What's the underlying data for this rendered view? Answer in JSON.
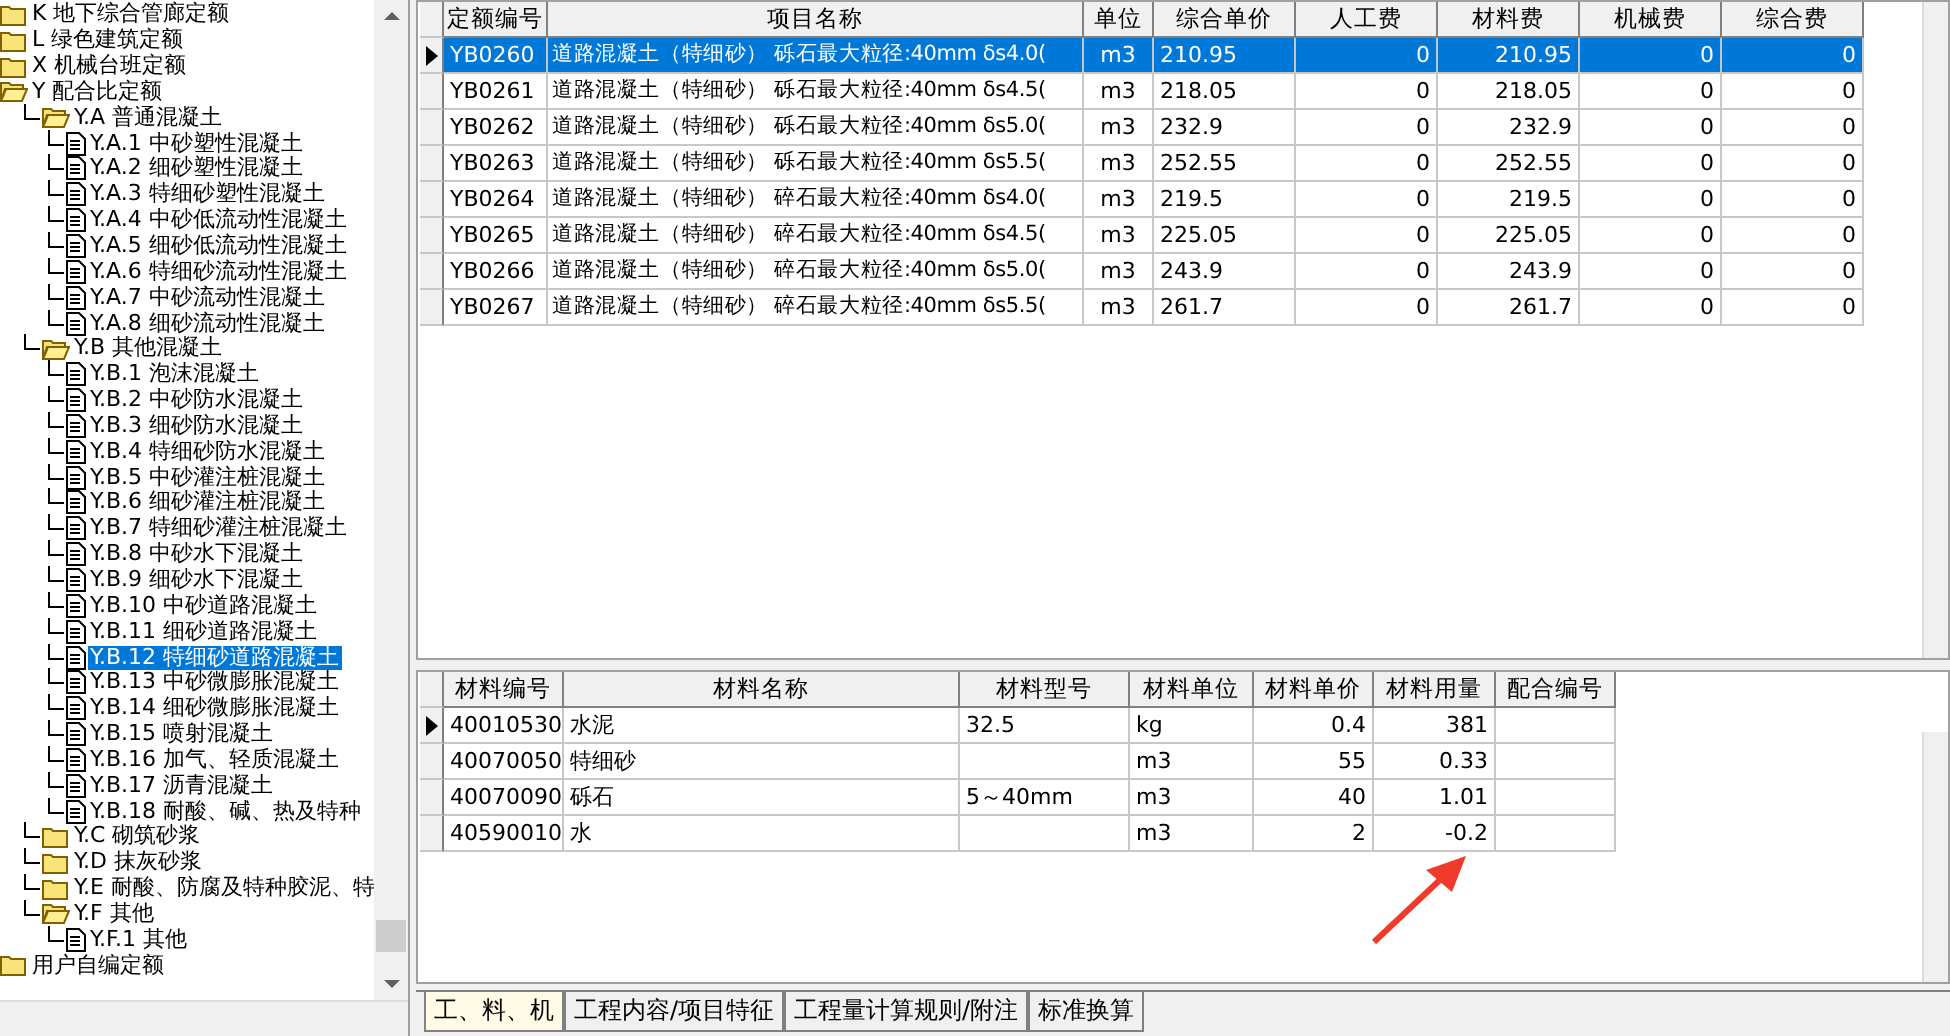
{
  "tree": {
    "items": [
      {
        "label": "K 地下综合管廊定额",
        "kind": "folder",
        "expanded": false,
        "selected": false
      },
      {
        "label": "L 绿色建筑定额",
        "kind": "folder",
        "expanded": false,
        "selected": false
      },
      {
        "label": "X 机械台班定额",
        "kind": "folder",
        "expanded": false,
        "selected": false
      },
      {
        "label": "Y 配合比定额",
        "kind": "folder",
        "expanded": true,
        "selected": false,
        "children": [
          {
            "label": "Y.A 普通混凝土",
            "kind": "folder",
            "expanded": true,
            "selected": false,
            "children": [
              {
                "label": "Y.A.1 中砂塑性混凝土",
                "kind": "doc",
                "selected": false
              },
              {
                "label": "Y.A.2 细砂塑性混凝土",
                "kind": "doc",
                "selected": false
              },
              {
                "label": "Y.A.3 特细砂塑性混凝土",
                "kind": "doc",
                "selected": false
              },
              {
                "label": "Y.A.4 中砂低流动性混凝土",
                "kind": "doc",
                "selected": false
              },
              {
                "label": "Y.A.5 细砂低流动性混凝土",
                "kind": "doc",
                "selected": false
              },
              {
                "label": "Y.A.6 特细砂流动性混凝土",
                "kind": "doc",
                "selected": false
              },
              {
                "label": "Y.A.7 中砂流动性混凝土",
                "kind": "doc",
                "selected": false
              },
              {
                "label": "Y.A.8 细砂流动性混凝土",
                "kind": "doc",
                "selected": false
              }
            ]
          },
          {
            "label": "Y.B 其他混凝土",
            "kind": "folder",
            "expanded": true,
            "selected": false,
            "children": [
              {
                "label": "Y.B.1 泡沫混凝土",
                "kind": "doc",
                "selected": false
              },
              {
                "label": "Y.B.2 中砂防水混凝土",
                "kind": "doc",
                "selected": false
              },
              {
                "label": "Y.B.3 细砂防水混凝土",
                "kind": "doc",
                "selected": false
              },
              {
                "label": "Y.B.4 特细砂防水混凝土",
                "kind": "doc",
                "selected": false
              },
              {
                "label": "Y.B.5 中砂灌注桩混凝土",
                "kind": "doc",
                "selected": false
              },
              {
                "label": "Y.B.6 细砂灌注桩混凝土",
                "kind": "doc",
                "selected": false
              },
              {
                "label": "Y.B.7 特细砂灌注桩混凝土",
                "kind": "doc",
                "selected": false
              },
              {
                "label": "Y.B.8 中砂水下混凝土",
                "kind": "doc",
                "selected": false
              },
              {
                "label": "Y.B.9 细砂水下混凝土",
                "kind": "doc",
                "selected": false
              },
              {
                "label": "Y.B.10 中砂道路混凝土",
                "kind": "doc",
                "selected": false
              },
              {
                "label": "Y.B.11 细砂道路混凝土",
                "kind": "doc",
                "selected": false
              },
              {
                "label": "Y.B.12 特细砂道路混凝土",
                "kind": "doc",
                "selected": true
              },
              {
                "label": "Y.B.13 中砂微膨胀混凝土",
                "kind": "doc",
                "selected": false
              },
              {
                "label": "Y.B.14 细砂微膨胀混凝土",
                "kind": "doc",
                "selected": false
              },
              {
                "label": "Y.B.15 喷射混凝土",
                "kind": "doc",
                "selected": false
              },
              {
                "label": "Y.B.16 加气、轻质混凝土",
                "kind": "doc",
                "selected": false
              },
              {
                "label": "Y.B.17 沥青混凝土",
                "kind": "doc",
                "selected": false
              },
              {
                "label": "Y.B.18 耐酸、碱、热及特种",
                "kind": "doc",
                "selected": false
              }
            ]
          },
          {
            "label": "Y.C 砌筑砂浆",
            "kind": "folder",
            "expanded": false,
            "selected": false
          },
          {
            "label": "Y.D 抹灰砂浆",
            "kind": "folder",
            "expanded": false,
            "selected": false
          },
          {
            "label": "Y.E 耐酸、防腐及特种胶泥、特",
            "kind": "folder",
            "expanded": false,
            "selected": false
          },
          {
            "label": "Y.F 其他",
            "kind": "folder",
            "expanded": true,
            "selected": false,
            "children": [
              {
                "label": "Y.F.1 其他",
                "kind": "doc",
                "selected": false
              }
            ]
          }
        ]
      },
      {
        "label": "用户自编定额",
        "kind": "folder",
        "expanded": false,
        "selected": false
      }
    ]
  },
  "quota_table": {
    "columns": [
      "定额编号",
      "项目名称",
      "单位",
      "综合单价",
      "人工费",
      "材料费",
      "机械费",
      "综合费"
    ],
    "rows": [
      {
        "selected": true,
        "cells": [
          "YB0260",
          "道路混凝土（特细砂） 砾石最大粒径:40mm δs4.0(",
          "m3",
          "210.95",
          "0",
          "210.95",
          "0",
          "0"
        ]
      },
      {
        "selected": false,
        "cells": [
          "YB0261",
          "道路混凝土（特细砂） 砾石最大粒径:40mm δs4.5(",
          "m3",
          "218.05",
          "0",
          "218.05",
          "0",
          "0"
        ]
      },
      {
        "selected": false,
        "cells": [
          "YB0262",
          "道路混凝土（特细砂） 砾石最大粒径:40mm δs5.0(",
          "m3",
          "232.9",
          "0",
          "232.9",
          "0",
          "0"
        ]
      },
      {
        "selected": false,
        "cells": [
          "YB0263",
          "道路混凝土（特细砂） 砾石最大粒径:40mm δs5.5(",
          "m3",
          "252.55",
          "0",
          "252.55",
          "0",
          "0"
        ]
      },
      {
        "selected": false,
        "cells": [
          "YB0264",
          "道路混凝土（特细砂） 碎石最大粒径:40mm δs4.0(",
          "m3",
          "219.5",
          "0",
          "219.5",
          "0",
          "0"
        ]
      },
      {
        "selected": false,
        "cells": [
          "YB0265",
          "道路混凝土（特细砂） 碎石最大粒径:40mm δs4.5(",
          "m3",
          "225.05",
          "0",
          "225.05",
          "0",
          "0"
        ]
      },
      {
        "selected": false,
        "cells": [
          "YB0266",
          "道路混凝土（特细砂） 碎石最大粒径:40mm δs5.0(",
          "m3",
          "243.9",
          "0",
          "243.9",
          "0",
          "0"
        ]
      },
      {
        "selected": false,
        "cells": [
          "YB0267",
          "道路混凝土（特细砂） 碎石最大粒径:40mm δs5.5(",
          "m3",
          "261.7",
          "0",
          "261.7",
          "0",
          "0"
        ]
      }
    ]
  },
  "material_table": {
    "columns": [
      "材料编号",
      "材料名称",
      "材料型号",
      "材料单位",
      "材料单价",
      "材料用量",
      "配合编号"
    ],
    "rows": [
      {
        "selected": true,
        "cells": [
          "40010530",
          "水泥",
          "32.5",
          "kg",
          "0.4",
          "381",
          ""
        ]
      },
      {
        "selected": false,
        "cells": [
          "40070050",
          "特细砂",
          "",
          "m3",
          "55",
          "0.33",
          ""
        ]
      },
      {
        "selected": false,
        "cells": [
          "40070090",
          "砾石",
          "5～40mm",
          "m3",
          "40",
          "1.01",
          ""
        ]
      },
      {
        "selected": false,
        "cells": [
          "40590010",
          "水",
          "",
          "m3",
          "2",
          "-0.2",
          ""
        ]
      }
    ]
  },
  "tabs": [
    {
      "label": "工、料、机",
      "selected": true
    },
    {
      "label": "工程内容/项目特征",
      "selected": false
    },
    {
      "label": "工程量计算规则/附注",
      "selected": false
    },
    {
      "label": "标准换算",
      "selected": false
    }
  ]
}
